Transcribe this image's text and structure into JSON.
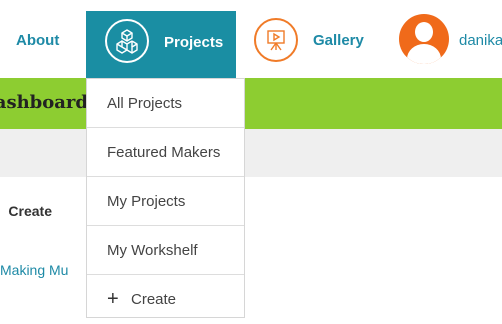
{
  "nav": {
    "about_label": "About",
    "projects_label": "Projects",
    "gallery_label": "Gallery",
    "username": "danikar"
  },
  "page": {
    "dashboard_title": "Dashboard",
    "create_label": "Create",
    "link_text": "Making Mu"
  },
  "dropdown": {
    "items": [
      {
        "label": "All Projects"
      },
      {
        "label": "Featured Makers"
      },
      {
        "label": "My Projects"
      },
      {
        "label": "My Workshelf"
      },
      {
        "label": "Create",
        "icon": "plus-icon"
      }
    ]
  },
  "colors": {
    "accent_teal": "#1a8ea3",
    "green_bar": "#8dcd31",
    "orange": "#f07b28"
  }
}
